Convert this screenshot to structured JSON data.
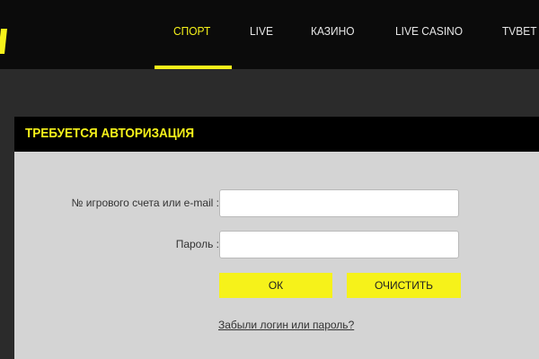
{
  "header": {
    "logo_icon": "logo-slash-icon",
    "accent_color": "#f6f21a",
    "nav": [
      {
        "label": "СПОРТ",
        "active": true
      },
      {
        "label": "LIVE",
        "active": false
      },
      {
        "label": "КАЗИНО",
        "active": false
      },
      {
        "label": "LIVE CASINO",
        "active": false
      },
      {
        "label": "TVBET",
        "active": false
      }
    ]
  },
  "login": {
    "title": "ТРЕБУЕТСЯ АВТОРИЗАЦИЯ",
    "account_label": "№ игрового счета или e-mail :",
    "account_value": "",
    "password_label": "Пароль :",
    "password_value": "",
    "ok_label": "ОК",
    "clear_label": "ОЧИСТИТЬ",
    "forgot_link": "Забыли логин или пароль?"
  }
}
